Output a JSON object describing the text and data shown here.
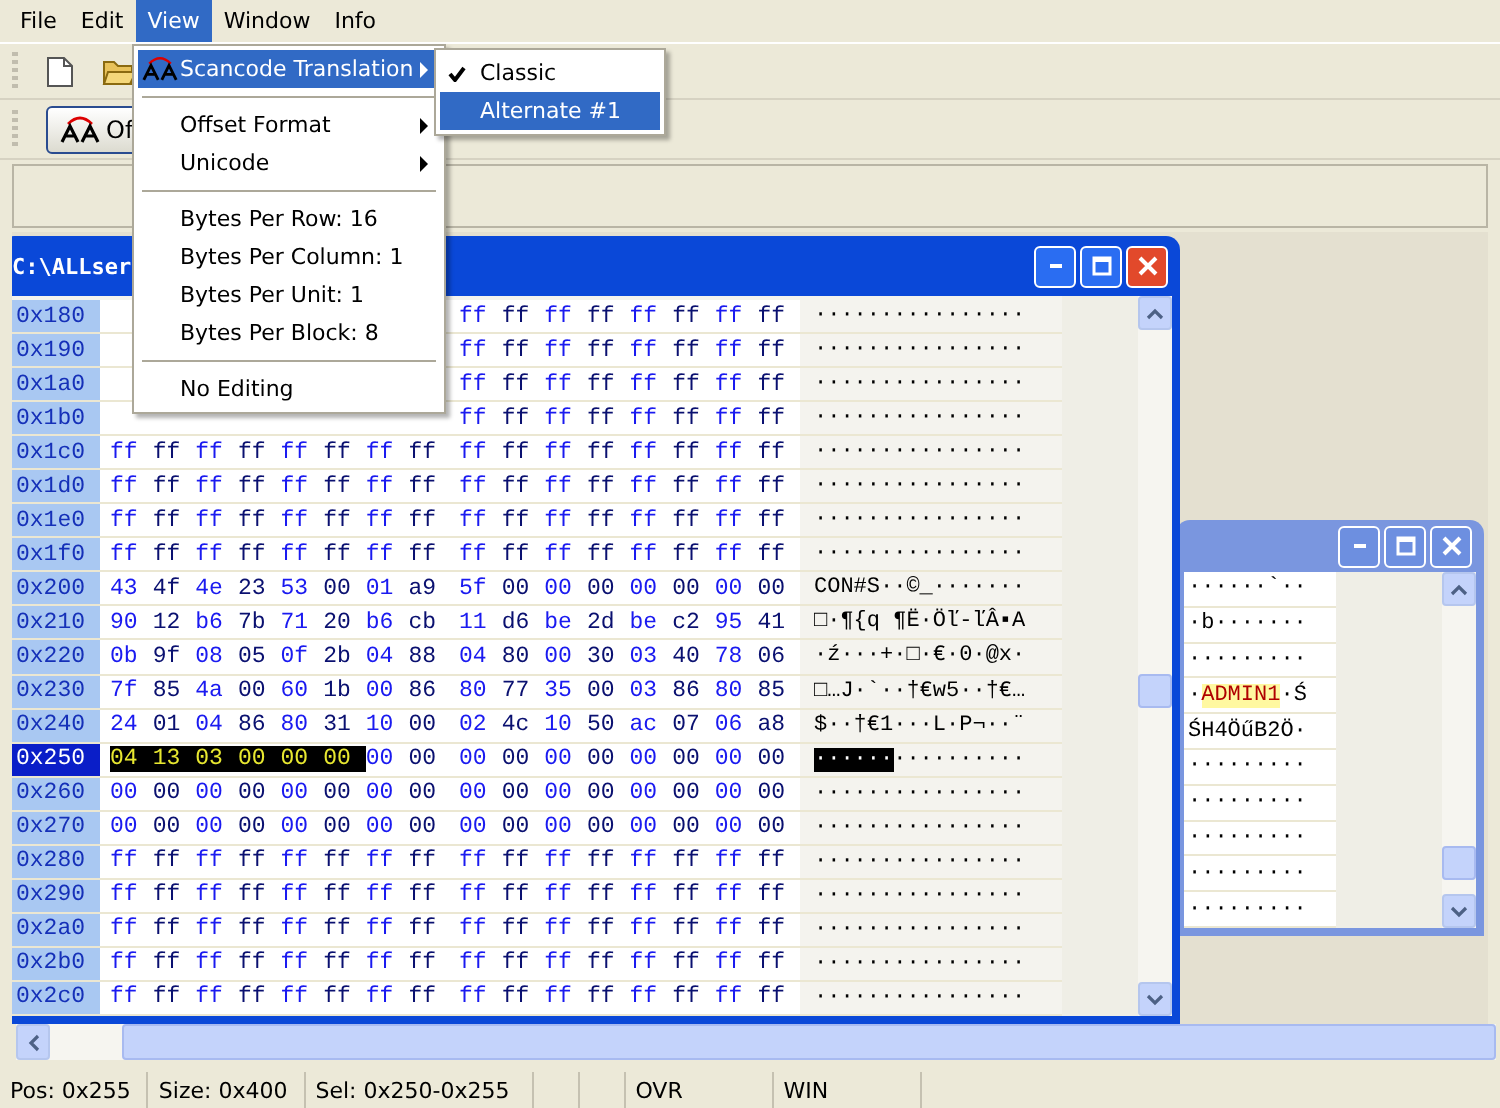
{
  "menubar": [
    {
      "label": "File",
      "selected": false
    },
    {
      "label": "Edit",
      "selected": false
    },
    {
      "label": "View",
      "selected": true
    },
    {
      "label": "Window",
      "selected": false
    },
    {
      "label": "Info",
      "selected": false
    }
  ],
  "toolbar_button": {
    "label": "Of"
  },
  "view_menu": [
    {
      "kind": "item",
      "label": "Scancode Translation",
      "submenu": true,
      "icon": true,
      "selected": true
    },
    {
      "kind": "separator"
    },
    {
      "kind": "item",
      "label": "Offset Format",
      "submenu": true,
      "icon": false,
      "selected": false
    },
    {
      "kind": "item",
      "label": "Unicode",
      "submenu": true,
      "icon": false,
      "selected": false
    },
    {
      "kind": "separator"
    },
    {
      "kind": "item",
      "label": "Bytes Per Row: 16",
      "submenu": false,
      "icon": false,
      "selected": false
    },
    {
      "kind": "item",
      "label": "Bytes Per Column: 1",
      "submenu": false,
      "icon": false,
      "selected": false
    },
    {
      "kind": "item",
      "label": "Bytes Per Unit: 1",
      "submenu": false,
      "icon": false,
      "selected": false
    },
    {
      "kind": "item",
      "label": "Bytes Per Block: 8",
      "submenu": false,
      "icon": false,
      "selected": false
    },
    {
      "kind": "separator"
    },
    {
      "kind": "item",
      "label": "No Editing",
      "submenu": false,
      "icon": false,
      "selected": false
    }
  ],
  "submenu": [
    {
      "label": "Classic",
      "checked": true,
      "selected": false
    },
    {
      "label": "Alternate #1",
      "checked": false,
      "selected": true
    }
  ],
  "main_window": {
    "title": "C:\\ALLser",
    "rows": [
      {
        "offset": "0x180",
        "selected": false,
        "covered": true,
        "bytes": [
          "ff",
          "ff",
          "ff",
          "ff",
          "ff",
          "ff",
          "ff",
          "ff"
        ],
        "ascii": "················"
      },
      {
        "offset": "0x190",
        "selected": false,
        "covered": true,
        "bytes": [
          "ff",
          "ff",
          "ff",
          "ff",
          "ff",
          "ff",
          "ff",
          "ff"
        ],
        "ascii": "················"
      },
      {
        "offset": "0x1a0",
        "selected": false,
        "covered": true,
        "bytes": [
          "ff",
          "ff",
          "ff",
          "ff",
          "ff",
          "ff",
          "ff",
          "ff"
        ],
        "ascii": "················"
      },
      {
        "offset": "0x1b0",
        "selected": false,
        "covered": true,
        "bytes": [
          "ff",
          "ff",
          "ff",
          "ff",
          "ff",
          "ff",
          "ff",
          "ff"
        ],
        "ascii": "················"
      },
      {
        "offset": "0x1c0",
        "selected": false,
        "bytes": [
          "ff",
          "ff",
          "ff",
          "ff",
          "ff",
          "ff",
          "ff",
          "ff",
          "ff",
          "ff",
          "ff",
          "ff",
          "ff",
          "ff",
          "ff",
          "ff"
        ],
        "ascii": "················"
      },
      {
        "offset": "0x1d0",
        "selected": false,
        "bytes": [
          "ff",
          "ff",
          "ff",
          "ff",
          "ff",
          "ff",
          "ff",
          "ff",
          "ff",
          "ff",
          "ff",
          "ff",
          "ff",
          "ff",
          "ff",
          "ff"
        ],
        "ascii": "················"
      },
      {
        "offset": "0x1e0",
        "selected": false,
        "bytes": [
          "ff",
          "ff",
          "ff",
          "ff",
          "ff",
          "ff",
          "ff",
          "ff",
          "ff",
          "ff",
          "ff",
          "ff",
          "ff",
          "ff",
          "ff",
          "ff"
        ],
        "ascii": "················"
      },
      {
        "offset": "0x1f0",
        "selected": false,
        "bytes": [
          "ff",
          "ff",
          "ff",
          "ff",
          "ff",
          "ff",
          "ff",
          "ff",
          "ff",
          "ff",
          "ff",
          "ff",
          "ff",
          "ff",
          "ff",
          "ff"
        ],
        "ascii": "················"
      },
      {
        "offset": "0x200",
        "selected": false,
        "bytes": [
          "43",
          "4f",
          "4e",
          "23",
          "53",
          "00",
          "01",
          "a9",
          "5f",
          "00",
          "00",
          "00",
          "00",
          "00",
          "00",
          "00"
        ],
        "ascii": "CON#S··©_·······"
      },
      {
        "offset": "0x210",
        "selected": false,
        "bytes": [
          "90",
          "12",
          "b6",
          "7b",
          "71",
          "20",
          "b6",
          "cb",
          "11",
          "d6",
          "be",
          "2d",
          "be",
          "c2",
          "95",
          "41"
        ],
        "ascii": "□·¶{q ¶Ë·Öľ-ľÂ▪A"
      },
      {
        "offset": "0x220",
        "selected": false,
        "bytes": [
          "0b",
          "9f",
          "08",
          "05",
          "0f",
          "2b",
          "04",
          "88",
          "04",
          "80",
          "00",
          "30",
          "03",
          "40",
          "78",
          "06"
        ],
        "ascii": "·ź···+·□·€·0·@x·"
      },
      {
        "offset": "0x230",
        "selected": false,
        "bytes": [
          "7f",
          "85",
          "4a",
          "00",
          "60",
          "1b",
          "00",
          "86",
          "80",
          "77",
          "35",
          "00",
          "03",
          "86",
          "80",
          "85"
        ],
        "ascii": "□…J·`··†€w5··†€…"
      },
      {
        "offset": "0x240",
        "selected": false,
        "bytes": [
          "24",
          "01",
          "04",
          "86",
          "80",
          "31",
          "10",
          "00",
          "02",
          "4c",
          "10",
          "50",
          "ac",
          "07",
          "06",
          "a8"
        ],
        "ascii": "$··†€1···L·P¬··¨"
      },
      {
        "offset": "0x250",
        "selected": true,
        "bytes_selected": [
          "04",
          "13",
          "03",
          "00",
          "00",
          "00"
        ],
        "bytes": [
          "00",
          "00",
          "00",
          "00",
          "00",
          "00",
          "00",
          "00",
          "00",
          "00"
        ],
        "ascii_selected": "······",
        "ascii": "··········"
      },
      {
        "offset": "0x260",
        "selected": false,
        "bytes": [
          "00",
          "00",
          "00",
          "00",
          "00",
          "00",
          "00",
          "00",
          "00",
          "00",
          "00",
          "00",
          "00",
          "00",
          "00",
          "00"
        ],
        "ascii": "················"
      },
      {
        "offset": "0x270",
        "selected": false,
        "bytes": [
          "00",
          "00",
          "00",
          "00",
          "00",
          "00",
          "00",
          "00",
          "00",
          "00",
          "00",
          "00",
          "00",
          "00",
          "00",
          "00"
        ],
        "ascii": "················"
      },
      {
        "offset": "0x280",
        "selected": false,
        "bytes": [
          "ff",
          "ff",
          "ff",
          "ff",
          "ff",
          "ff",
          "ff",
          "ff",
          "ff",
          "ff",
          "ff",
          "ff",
          "ff",
          "ff",
          "ff",
          "ff"
        ],
        "ascii": "················"
      },
      {
        "offset": "0x290",
        "selected": false,
        "bytes": [
          "ff",
          "ff",
          "ff",
          "ff",
          "ff",
          "ff",
          "ff",
          "ff",
          "ff",
          "ff",
          "ff",
          "ff",
          "ff",
          "ff",
          "ff",
          "ff"
        ],
        "ascii": "················"
      },
      {
        "offset": "0x2a0",
        "selected": false,
        "bytes": [
          "ff",
          "ff",
          "ff",
          "ff",
          "ff",
          "ff",
          "ff",
          "ff",
          "ff",
          "ff",
          "ff",
          "ff",
          "ff",
          "ff",
          "ff",
          "ff"
        ],
        "ascii": "················"
      },
      {
        "offset": "0x2b0",
        "selected": false,
        "bytes": [
          "ff",
          "ff",
          "ff",
          "ff",
          "ff",
          "ff",
          "ff",
          "ff",
          "ff",
          "ff",
          "ff",
          "ff",
          "ff",
          "ff",
          "ff",
          "ff"
        ],
        "ascii": "················"
      },
      {
        "offset": "0x2c0",
        "selected": false,
        "bytes": [
          "ff",
          "ff",
          "ff",
          "ff",
          "ff",
          "ff",
          "ff",
          "ff",
          "ff",
          "ff",
          "ff",
          "ff",
          "ff",
          "ff",
          "ff",
          "ff"
        ],
        "ascii": "················"
      }
    ]
  },
  "second_window": {
    "rows": [
      [
        {
          "text": "······`··",
          "highlighted": false
        }
      ],
      [
        {
          "text": "·b·······",
          "highlighted": false
        }
      ],
      [
        {
          "text": "·········",
          "highlighted": false
        }
      ],
      [
        {
          "text": "·",
          "highlighted": false
        },
        {
          "text": "ADMIN1",
          "highlighted": true
        },
        {
          "text": "·Ś",
          "highlighted": false
        }
      ],
      [
        {
          "text": "ŚH4ÖűB2Ö·",
          "highlighted": false
        }
      ],
      [
        {
          "text": "·········",
          "highlighted": false
        }
      ],
      [
        {
          "text": "·········",
          "highlighted": false
        }
      ],
      [
        {
          "text": "·········",
          "highlighted": false
        }
      ],
      [
        {
          "text": "·········",
          "highlighted": false
        }
      ],
      [
        {
          "text": "·········",
          "highlighted": false
        }
      ]
    ]
  },
  "status_bar": [
    "Pos: 0x255",
    "Size: 0x400",
    "Sel: 0x250-0x255",
    "OVR",
    "WIN"
  ]
}
